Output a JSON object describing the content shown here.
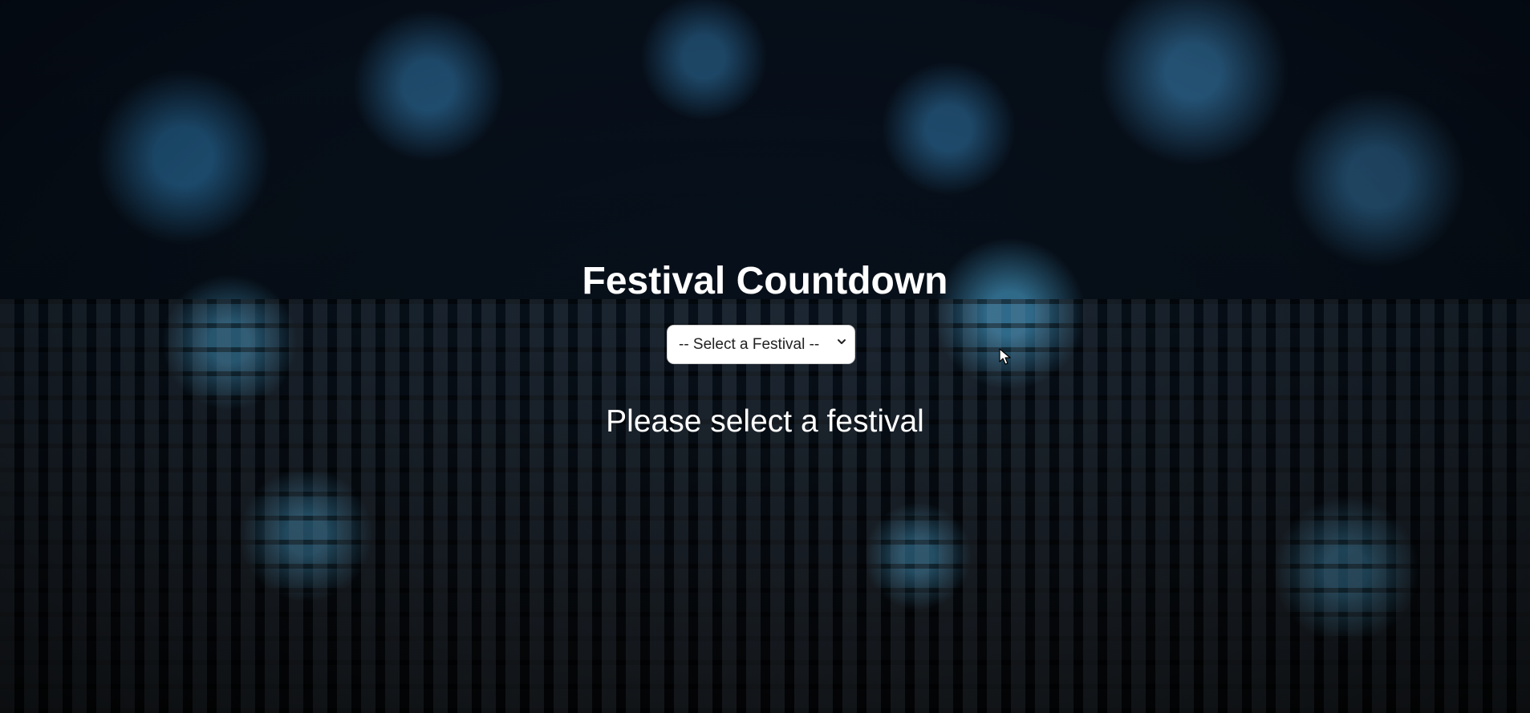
{
  "header": {
    "title": "Festival Countdown"
  },
  "festival_select": {
    "selected_label": "-- Select a Festival --",
    "options": [
      "-- Select a Festival --"
    ]
  },
  "status": {
    "message": "Please select a festival"
  },
  "icons": {
    "dropdown": "chevron-down-icon",
    "pointer": "mouse-cursor-icon"
  },
  "colors": {
    "title_text": "#ffffff",
    "background_accent": "#3aa0e6",
    "select_background": "#ffffff"
  }
}
